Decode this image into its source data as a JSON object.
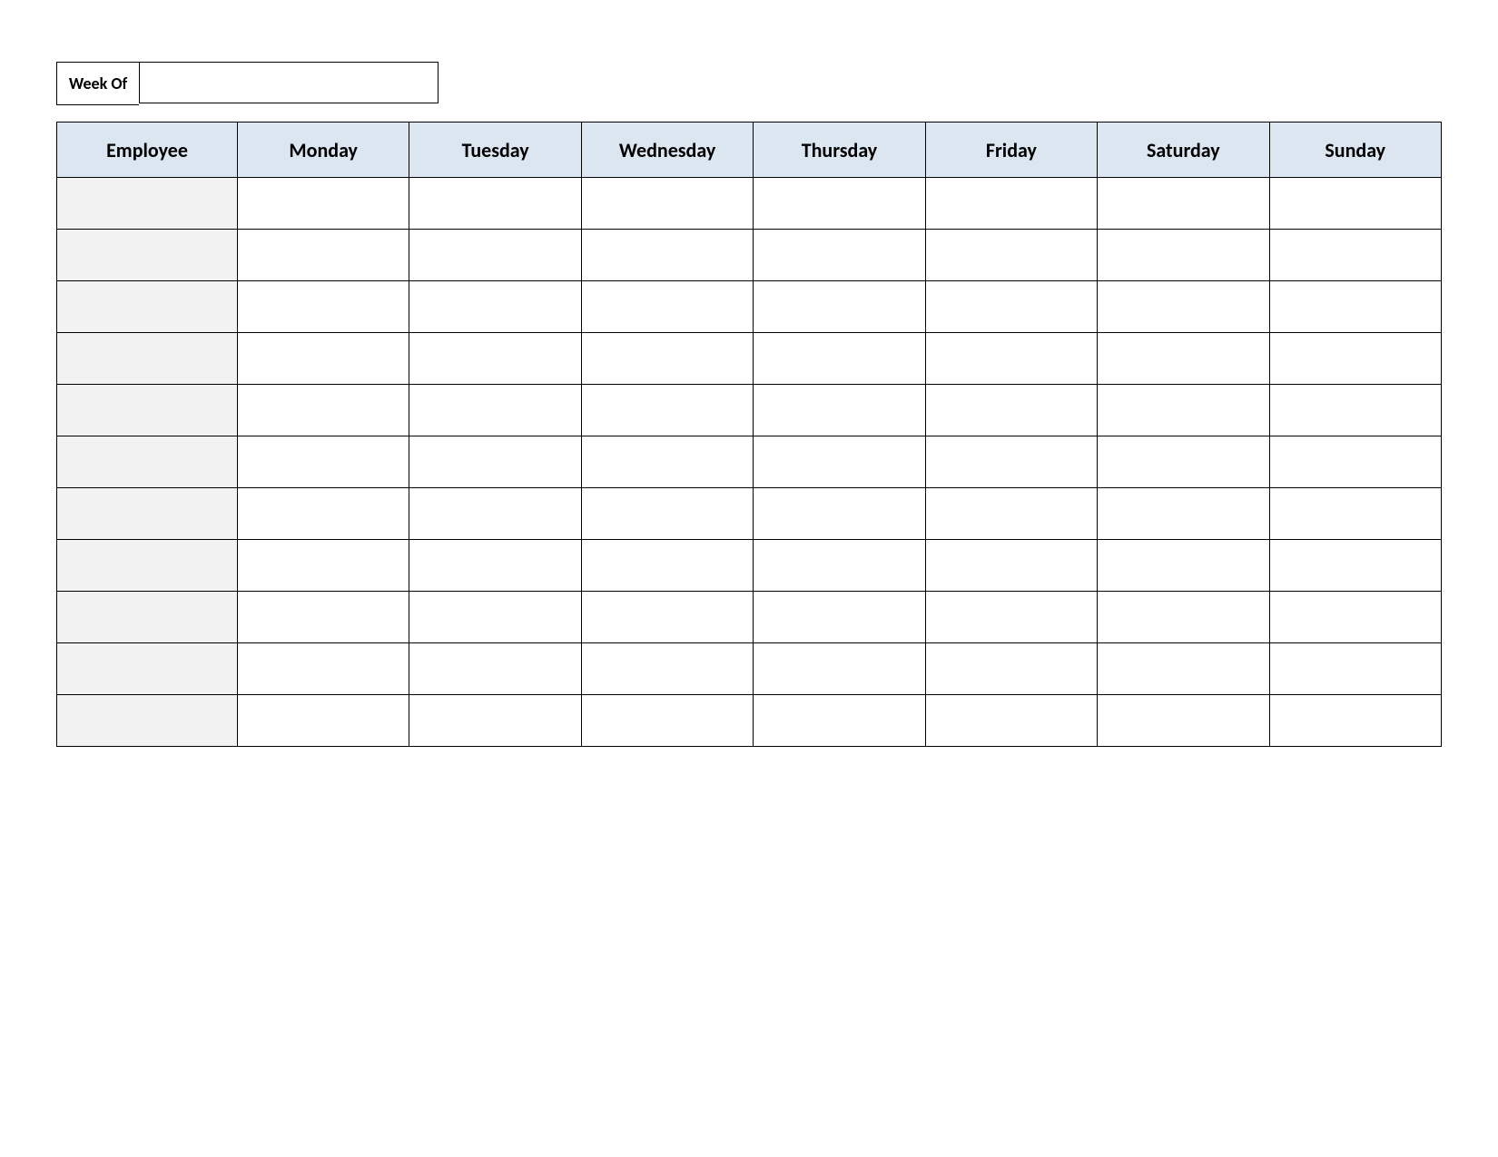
{
  "weekOf": {
    "label": "Week Of",
    "value": ""
  },
  "schedule": {
    "headers": [
      "Employee",
      "Monday",
      "Tuesday",
      "Wednesday",
      "Thursday",
      "Friday",
      "Saturday",
      "Sunday"
    ],
    "rows": [
      {
        "employee": "",
        "days": [
          "",
          "",
          "",
          "",
          "",
          "",
          ""
        ]
      },
      {
        "employee": "",
        "days": [
          "",
          "",
          "",
          "",
          "",
          "",
          ""
        ]
      },
      {
        "employee": "",
        "days": [
          "",
          "",
          "",
          "",
          "",
          "",
          ""
        ]
      },
      {
        "employee": "",
        "days": [
          "",
          "",
          "",
          "",
          "",
          "",
          ""
        ]
      },
      {
        "employee": "",
        "days": [
          "",
          "",
          "",
          "",
          "",
          "",
          ""
        ]
      },
      {
        "employee": "",
        "days": [
          "",
          "",
          "",
          "",
          "",
          "",
          ""
        ]
      },
      {
        "employee": "",
        "days": [
          "",
          "",
          "",
          "",
          "",
          "",
          ""
        ]
      },
      {
        "employee": "",
        "days": [
          "",
          "",
          "",
          "",
          "",
          "",
          ""
        ]
      },
      {
        "employee": "",
        "days": [
          "",
          "",
          "",
          "",
          "",
          "",
          ""
        ]
      },
      {
        "employee": "",
        "days": [
          "",
          "",
          "",
          "",
          "",
          "",
          ""
        ]
      },
      {
        "employee": "",
        "days": [
          "",
          "",
          "",
          "",
          "",
          "",
          ""
        ]
      }
    ]
  }
}
